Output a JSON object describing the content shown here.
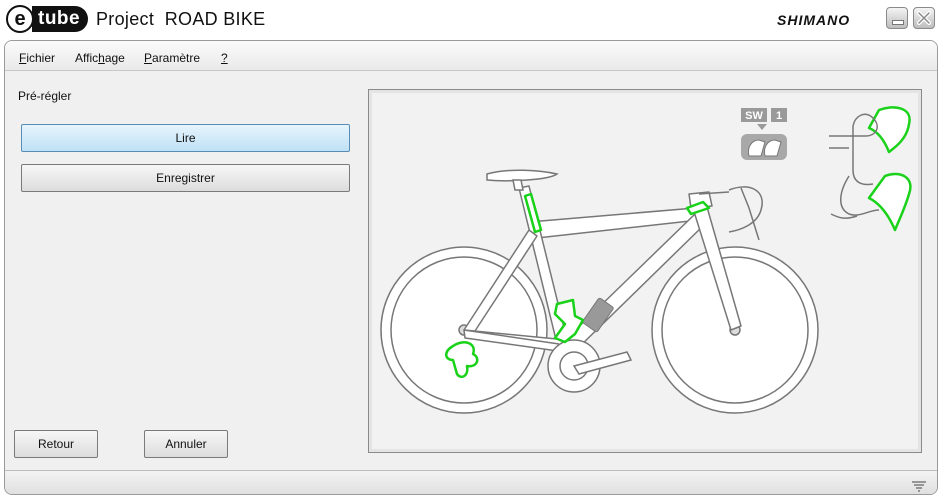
{
  "window": {
    "logo_mark": "e",
    "logo_text": "tube",
    "title": "Project  ROAD BIKE",
    "brand": "SHIMANO",
    "minimize_icon": "minimize-icon",
    "close_icon": "close-icon"
  },
  "menu": {
    "items": [
      {
        "pre": "",
        "u": "F",
        "post": "ichier"
      },
      {
        "pre": "Affic",
        "u": "h",
        "post": "age"
      },
      {
        "pre": "",
        "u": "P",
        "post": "aramètre"
      },
      {
        "pre": "",
        "u": "?",
        "post": ""
      }
    ]
  },
  "preset": {
    "label": "Pré-régler",
    "read_button": "Lire",
    "save_button": "Enregistrer"
  },
  "footer": {
    "back_button": "Retour",
    "cancel_button": "Annuler"
  },
  "bike_panel": {
    "switch_label": "SW",
    "switch_number": "1",
    "highlight_color": "#19d219",
    "frame_color": "#ffffff",
    "outline_color": "#777777"
  }
}
